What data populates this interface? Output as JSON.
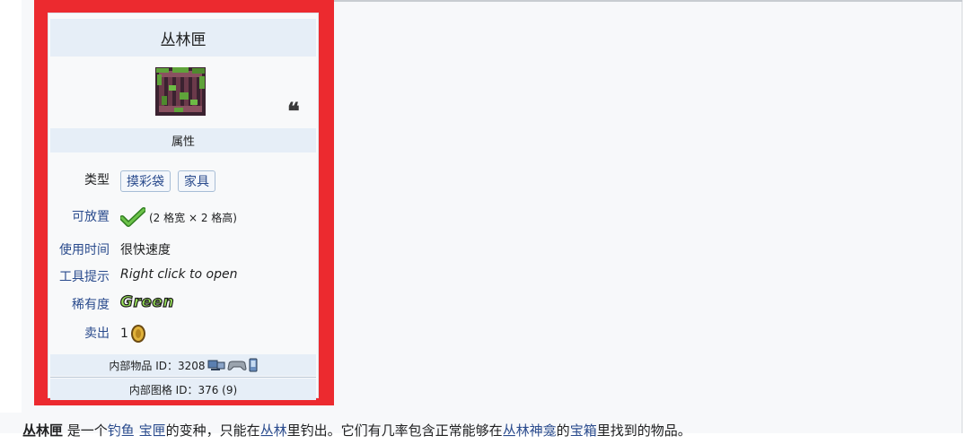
{
  "infobox": {
    "title": "丛林匣",
    "section_header": "属性",
    "rows": [
      {
        "label": "类型",
        "tags": [
          "摸彩袋",
          "家具"
        ]
      },
      {
        "label": "可放置",
        "value": "(2 格宽 × 2 格高)"
      },
      {
        "label": "使用时间",
        "value": "很快速度"
      },
      {
        "label": "工具提示",
        "value": "Right click to open"
      },
      {
        "label": "稀有度",
        "value": "Green"
      },
      {
        "label": "卖出",
        "value": "1"
      }
    ],
    "internal_item_id": "内部物品 ID：3208",
    "internal_tile_id": "内部图格 ID：376 (9)"
  },
  "paragraph": {
    "p1": "丛林匣",
    "p2": " 是一个",
    "l1": "钓鱼",
    "p3": " ",
    "l2": "宝匣",
    "p4": "的变种，只能在",
    "l3": "丛林",
    "p5": "里钓出。它们有几率包含正常能够在",
    "l4": "丛林神龛",
    "p6": "的",
    "l5": "宝箱",
    "p7": "里找到的物品。"
  },
  "colors": {
    "highlight_frame": "#ec2a2f",
    "link": "#2a4b8d",
    "rarity_green": "#9ae35a"
  }
}
